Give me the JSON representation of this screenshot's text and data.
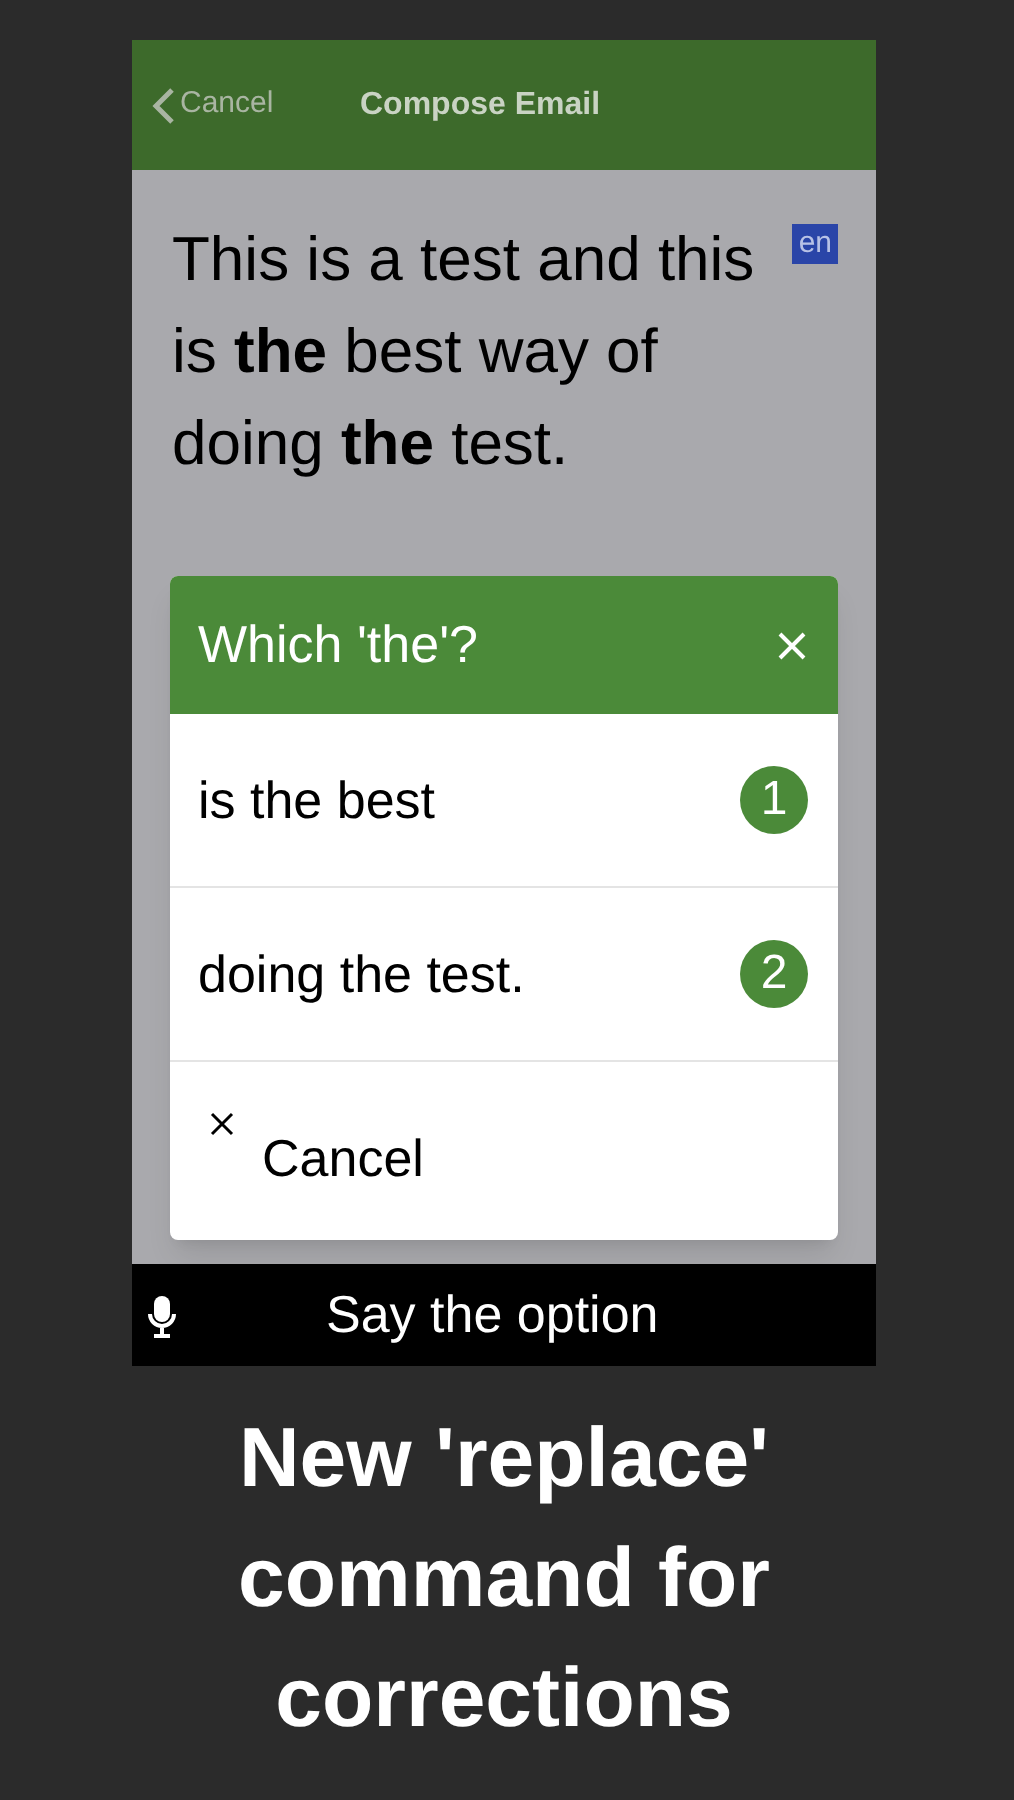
{
  "nav_bar": {
    "back_label": "Cancel",
    "title": "Compose Email"
  },
  "editor": {
    "text": "This is a test and this is **the** best way of doing **the** test.",
    "language_badge": "en"
  },
  "dialog": {
    "title": "Which 'the'?",
    "options": [
      {
        "kind": "choice",
        "label": "is the best",
        "number": "1"
      },
      {
        "kind": "choice",
        "label": "doing the test.",
        "number": "2"
      },
      {
        "kind": "cancel",
        "label": "Cancel"
      }
    ]
  },
  "voice_bar": {
    "prompt": "Say the option"
  },
  "caption": "New 'replace' command for corrections"
}
